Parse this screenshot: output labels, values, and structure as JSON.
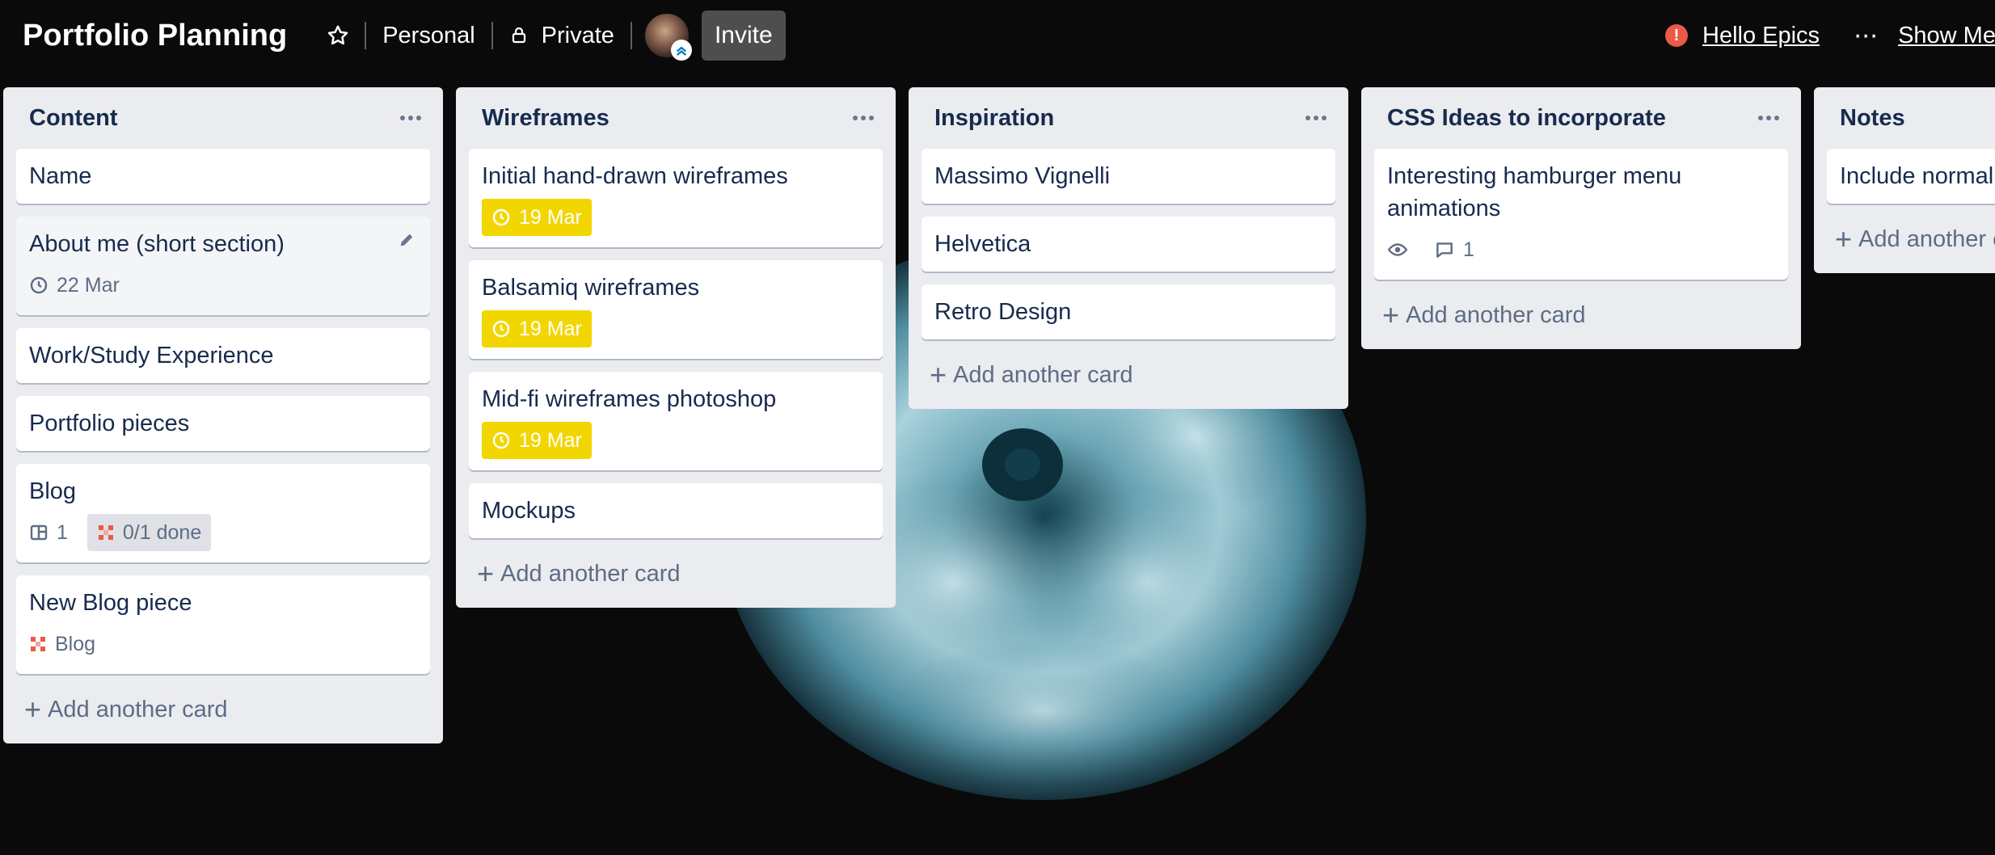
{
  "header": {
    "board_title": "Portfolio Planning",
    "workspace_label": "Personal",
    "visibility_label": "Private",
    "invite_label": "Invite",
    "alert_mark": "!",
    "power_up_label": "Hello Epics",
    "menu_label": "Show Menu"
  },
  "lists": [
    {
      "title": "Content",
      "cards": [
        {
          "title": "Name"
        },
        {
          "title": "About me (short section)",
          "due": "22 Mar"
        },
        {
          "title": "Work/Study Experience"
        },
        {
          "title": "Portfolio pieces"
        },
        {
          "title": "Blog",
          "attachments": "1",
          "epic_progress": "0/1 done"
        },
        {
          "title": "New Blog piece",
          "epic_label": "Blog"
        }
      ],
      "add_label": "Add another card"
    },
    {
      "title": "Wireframes",
      "cards": [
        {
          "title": "Initial hand-drawn wireframes",
          "due": "19 Mar"
        },
        {
          "title": "Balsamiq wireframes",
          "due": "19 Mar"
        },
        {
          "title": "Mid-fi wireframes photoshop",
          "due": "19 Mar"
        },
        {
          "title": "Mockups"
        }
      ],
      "add_label": "Add another card"
    },
    {
      "title": "Inspiration",
      "cards": [
        {
          "title": "Massimo Vignelli"
        },
        {
          "title": "Helvetica"
        },
        {
          "title": "Retro Design"
        }
      ],
      "add_label": "Add another card"
    },
    {
      "title": "CSS Ideas to incorporate",
      "cards": [
        {
          "title": "Interesting hamburger menu animations",
          "comments": "1"
        }
      ],
      "add_label": "Add another card"
    },
    {
      "title": "Notes",
      "cards": [
        {
          "title": "Include normalize"
        }
      ],
      "add_label": "Add another card"
    }
  ],
  "colors": {
    "list_bg": "#ebecf0",
    "due_badge": "#f2d600",
    "epic_red": "#eb5a46",
    "page_bg": "#0a0a0a",
    "flower": "#5f99ab"
  }
}
